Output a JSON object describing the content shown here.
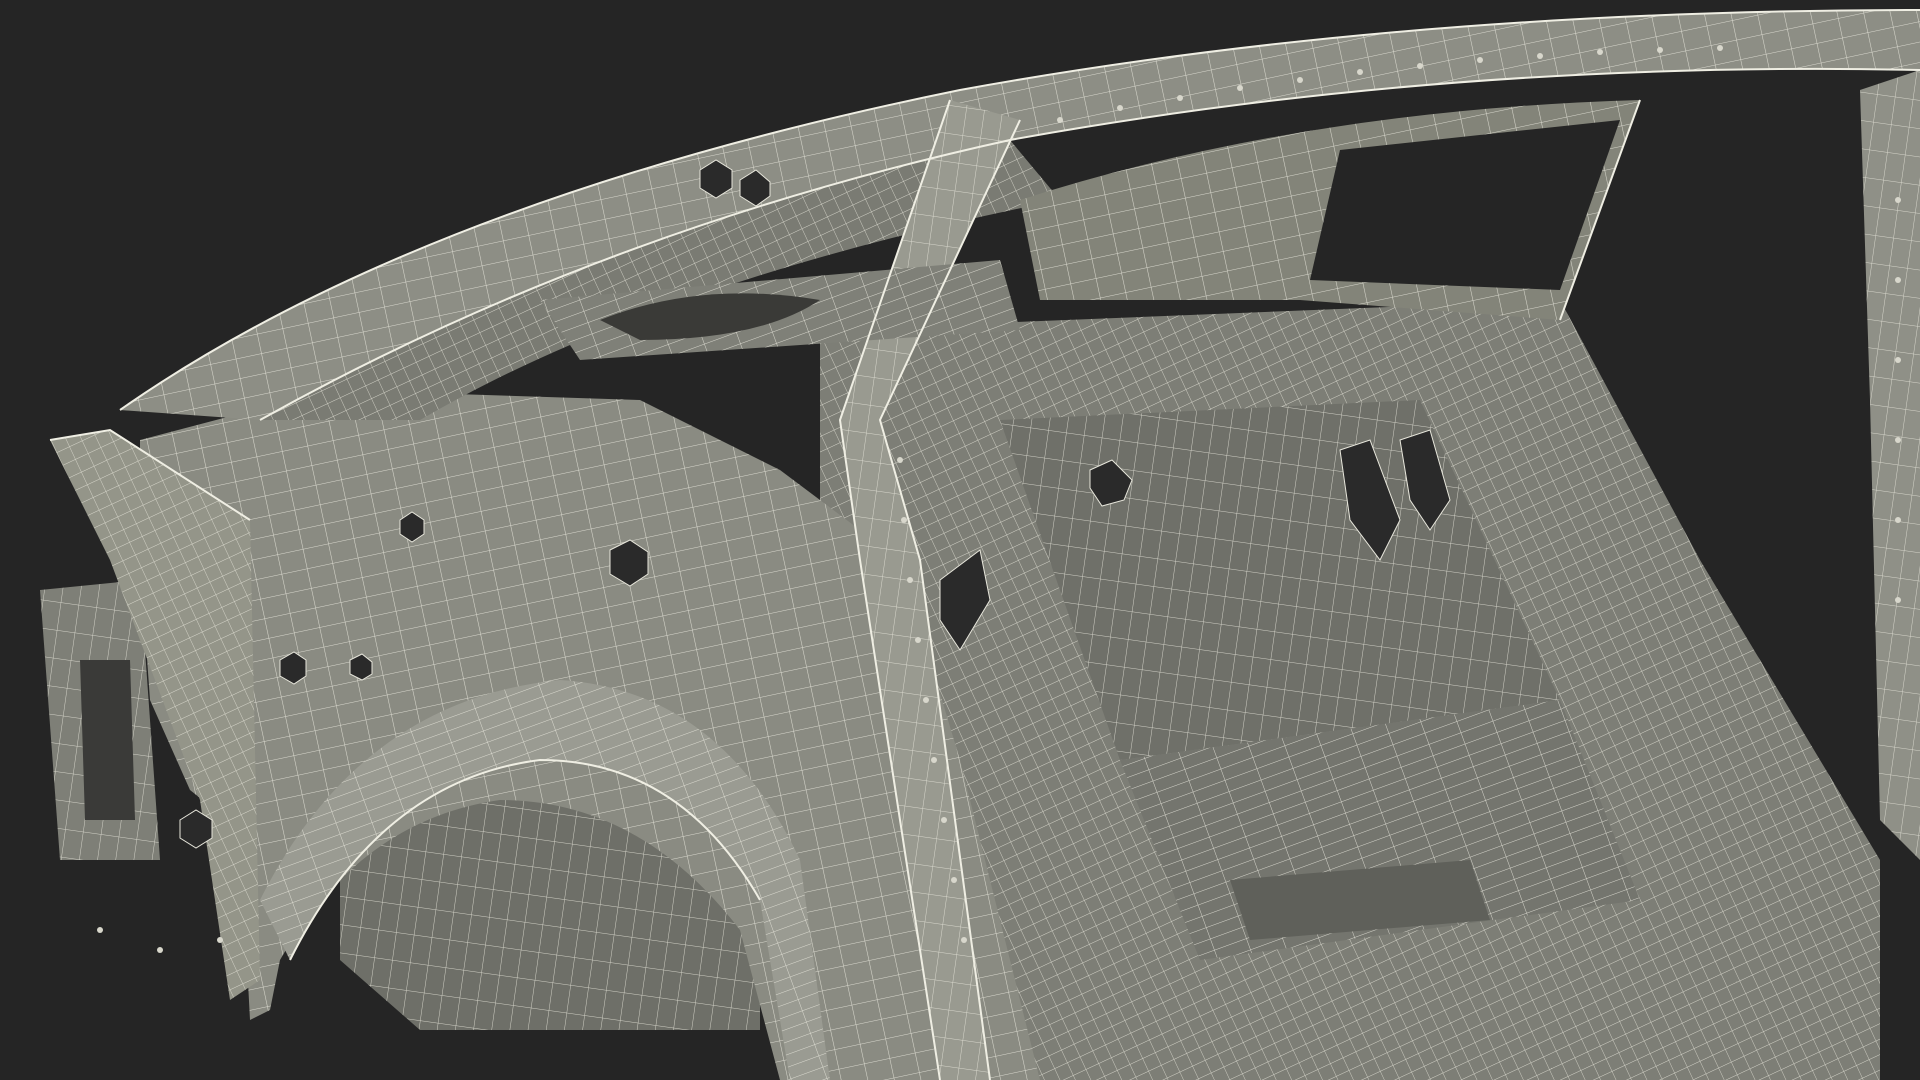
{
  "scene": {
    "subject": "car-body-in-white-wireframe-render",
    "background_color": "#252525",
    "surface_color": "#8a8b82",
    "surface_shade_color": "#6e6f68",
    "surface_highlight_color": "#a3a49b",
    "wire_color": "#e8e7dc",
    "hole_color": "#2a2a2a"
  }
}
